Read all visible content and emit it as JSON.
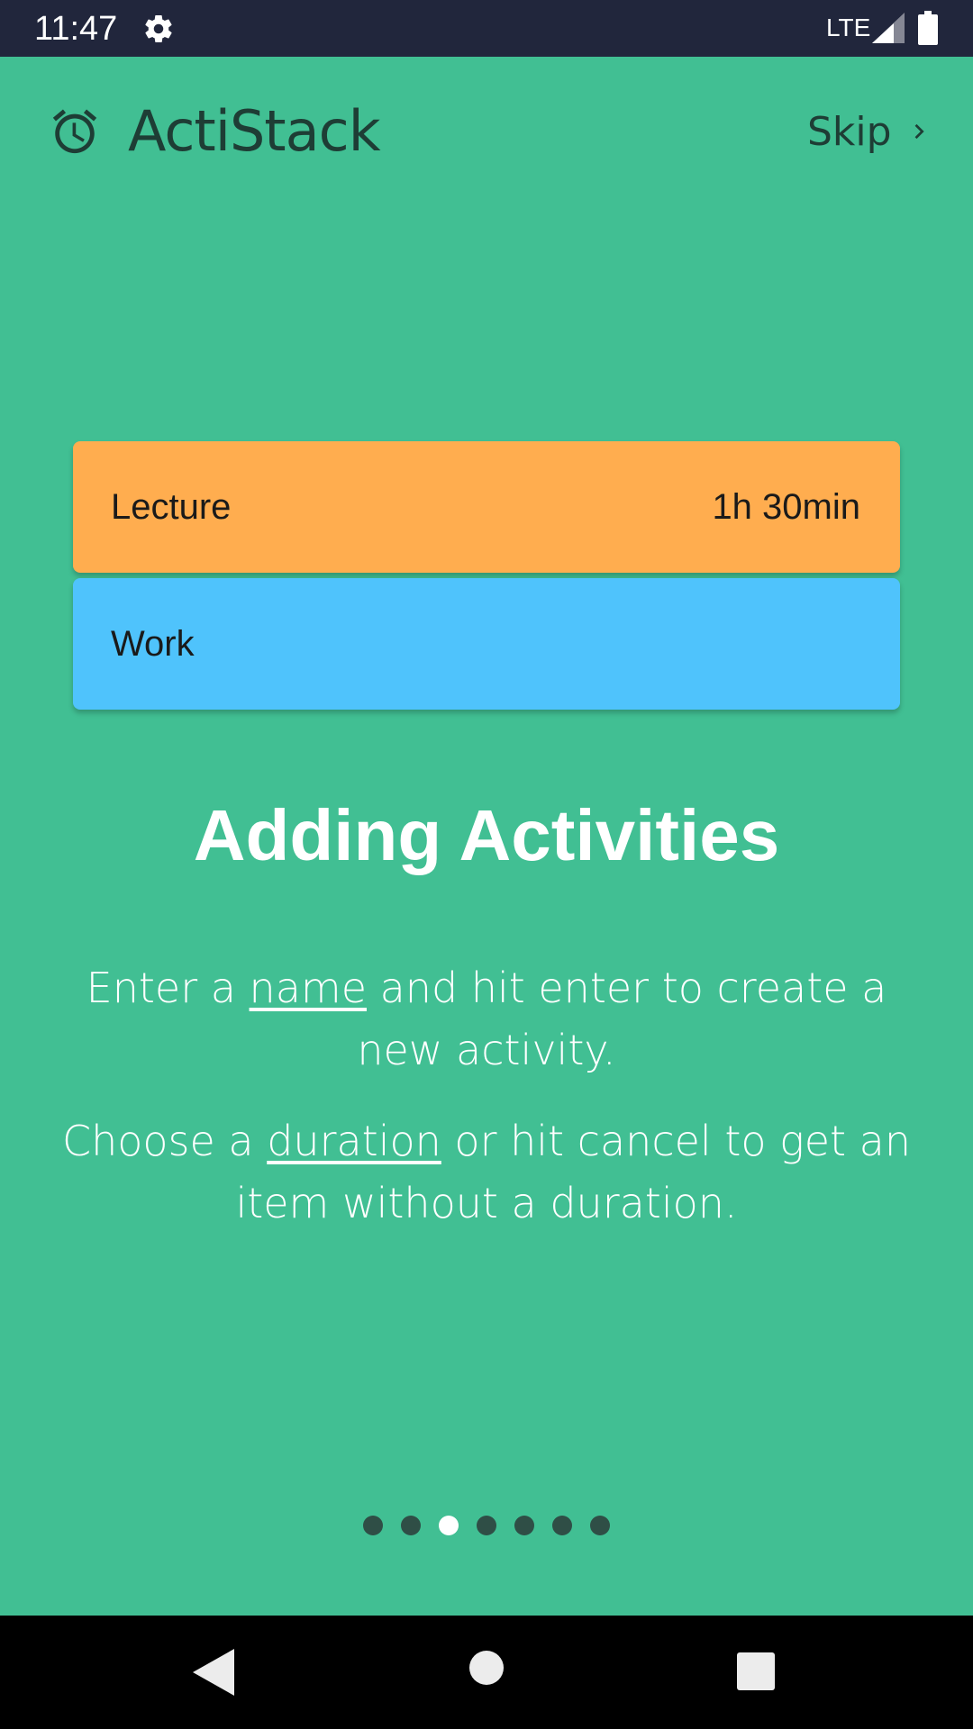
{
  "status_bar": {
    "time": "11:47",
    "network": "LTE",
    "icons": [
      "gear-icon",
      "signal-icon",
      "battery-icon"
    ]
  },
  "header": {
    "app_name": "ActiStack",
    "logo_icon": "alarm-clock-icon",
    "skip_label": "Skip",
    "skip_icon": "chevron-right-icon"
  },
  "activities": [
    {
      "name": "Lecture",
      "duration": "1h 30min",
      "color": "#ffad4f"
    },
    {
      "name": "Work",
      "duration": "",
      "color": "#4fc3fc"
    }
  ],
  "slide": {
    "title": "Adding Activities",
    "line1_pre": "Enter a ",
    "line1_link": "name",
    "line1_post": " and hit enter to create a new activity.",
    "line2_pre": "Choose a ",
    "line2_link": "duration",
    "line2_post": " or hit cancel to get an item without a duration."
  },
  "pager": {
    "total": 7,
    "current": 3
  },
  "colors": {
    "background": "#41bf93",
    "status_bar": "#21263c",
    "header_text": "#1e3d35",
    "dot_inactive": "#2f4e46",
    "dot_active": "#ffffff"
  },
  "nav_bar": {
    "icons": [
      "back-icon",
      "home-icon",
      "recents-icon"
    ]
  }
}
